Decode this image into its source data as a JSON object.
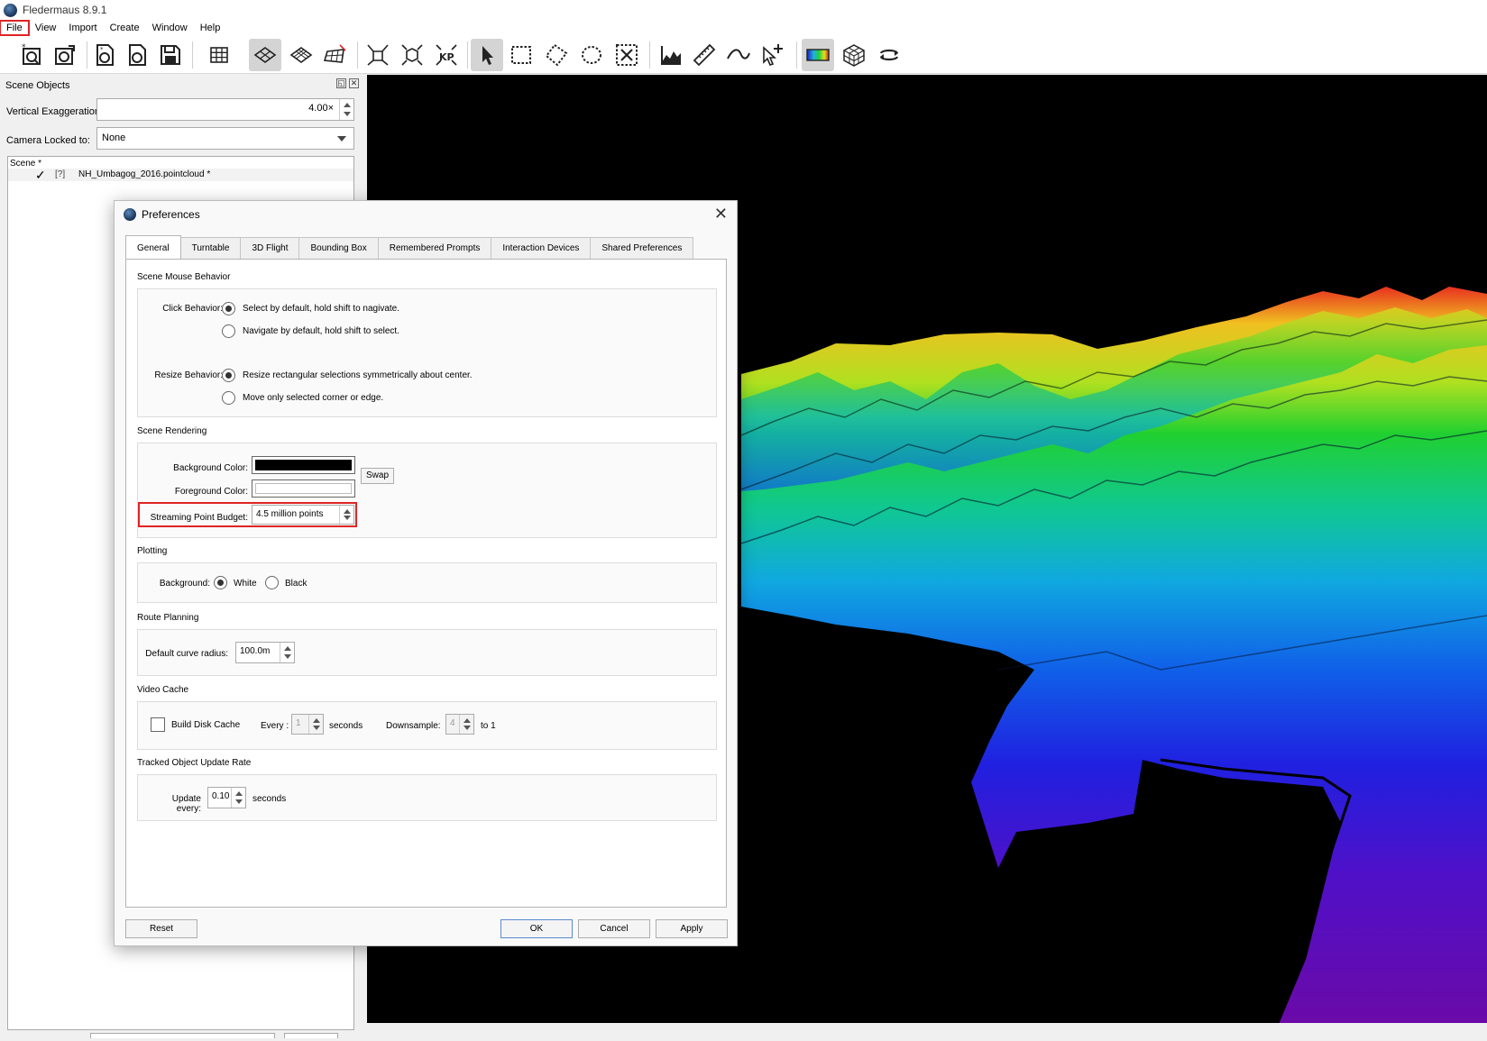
{
  "window": {
    "title": "Fledermaus 8.9.1"
  },
  "menu": {
    "items": [
      "File",
      "View",
      "Import",
      "Create",
      "Window",
      "Help"
    ],
    "active": "File"
  },
  "toolbar": {
    "buttons": [
      {
        "icon": "new-scene-icon"
      },
      {
        "icon": "open-scene-icon"
      },
      {
        "icon": "load-objects-icon"
      },
      {
        "icon": "save-objects-icon"
      },
      {
        "icon": "save-icon"
      },
      {
        "icon": "grid-icon"
      },
      {
        "icon": "plan-view-icon"
      },
      {
        "icon": "perspective-grid-icon"
      },
      {
        "icon": "tilted-grid-icon"
      },
      {
        "icon": "fit-all-icon"
      },
      {
        "icon": "fit-object-icon"
      },
      {
        "icon": "kp-icon"
      },
      {
        "icon": "select-arrow-icon"
      },
      {
        "icon": "rectangle-select-icon"
      },
      {
        "icon": "polygon-select-icon"
      },
      {
        "icon": "lasso-select-icon"
      },
      {
        "icon": "clear-selection-icon"
      },
      {
        "icon": "profile-chart-icon"
      },
      {
        "icon": "measure-ruler-icon"
      },
      {
        "icon": "curve-tool-icon"
      },
      {
        "icon": "add-point-icon"
      },
      {
        "icon": "colormap-icon"
      },
      {
        "icon": "wireframe-cube-icon"
      },
      {
        "icon": "rotate-icon"
      }
    ]
  },
  "scene_panel": {
    "title": "Scene Objects",
    "vertical_exaggeration_label": "Vertical Exaggeration:",
    "vertical_exaggeration_value": "4.00×",
    "camera_locked_label": "Camera Locked to:",
    "camera_locked_value": "None",
    "tree_header": "Scene *",
    "tree_item": "NH_Umbagog_2016.pointcloud *",
    "tree_item_icon": "[?]"
  },
  "prefs": {
    "title": "Preferences",
    "tabs": [
      "General",
      "Turntable",
      "3D Flight",
      "Bounding Box",
      "Remembered Prompts",
      "Interaction Devices",
      "Shared Preferences"
    ],
    "active_tab": "General",
    "mouse": {
      "section": "Scene Mouse Behavior",
      "click_label": "Click Behavior:",
      "click_opt1": "Select by default, hold shift to nagivate.",
      "click_opt2": "Navigate by default, hold shift to select.",
      "resize_label": "Resize Behavior:",
      "resize_opt1": "Resize rectangular selections symmetrically about center.",
      "resize_opt2": "Move only selected corner or edge."
    },
    "rendering": {
      "section": "Scene Rendering",
      "bg_label": "Background Color:",
      "bg_color": "#000000",
      "fg_label": "Foreground Color:",
      "fg_color": "#ffffff",
      "swap": "Swap",
      "budget_label": "Streaming Point Budget:",
      "budget_value": "4.5 million points"
    },
    "plotting": {
      "section": "Plotting",
      "bg_label": "Background:",
      "white": "White",
      "black": "Black"
    },
    "route": {
      "section": "Route Planning",
      "radius_label": "Default curve radius:",
      "radius_value": "100.0m"
    },
    "video": {
      "section": "Video Cache",
      "build_label": "Build Disk Cache",
      "every_label": "Every :",
      "every_value": "1",
      "seconds": "seconds",
      "downsample_label": "Downsample:",
      "downsample_value": "4",
      "to_one": "to 1"
    },
    "tracked": {
      "section": "Tracked Object Update Rate",
      "update_label": "Update every:",
      "update_value": "0.10",
      "seconds": "seconds"
    },
    "buttons": {
      "reset": "Reset",
      "ok": "OK",
      "cancel": "Cancel",
      "apply": "Apply"
    }
  },
  "colors": {
    "highlight": "#e02424"
  }
}
